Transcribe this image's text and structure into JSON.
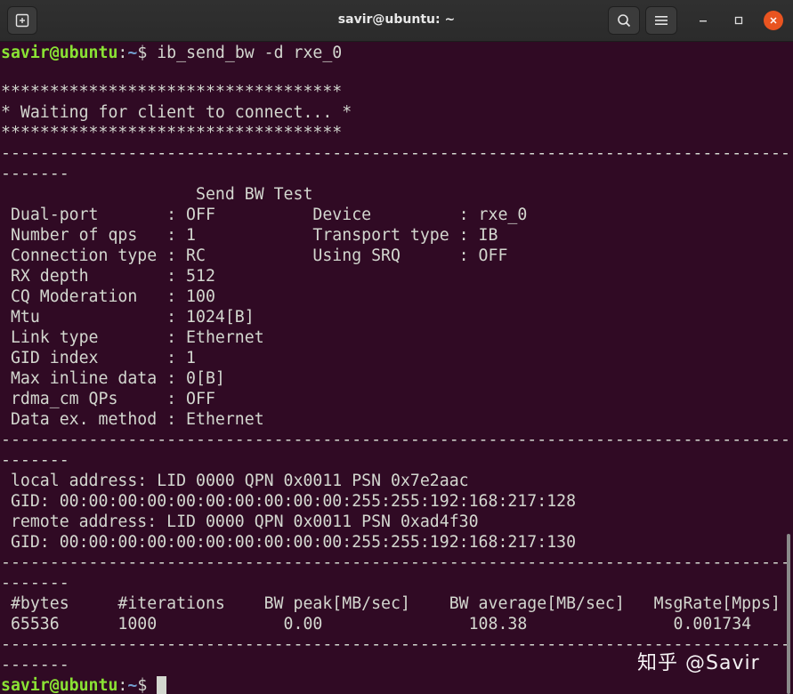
{
  "window": {
    "title": "savir@ubuntu: ~"
  },
  "icons": {
    "new_tab": "new-tab-icon",
    "search": "search-icon",
    "menu": "hamburger-menu-icon",
    "minimize": "minimize-icon",
    "maximize": "maximize-icon",
    "close": "close-icon"
  },
  "colors": {
    "prompt_user": "#8ae234",
    "prompt_path": "#729fcf",
    "background": "#300a24",
    "close_button": "#e95420"
  },
  "prompt": {
    "user": "savir@ubuntu",
    "sep": ":",
    "path": "~",
    "symbol": "$"
  },
  "command": " ib_send_bw -d rxe_0",
  "output": [
    "***********************************",
    "* Waiting for client to connect... *",
    "***********************************",
    "---------------------------------------------------------------------------------",
    "-------",
    "                    Send BW Test",
    " Dual-port       : OFF          Device         : rxe_0",
    " Number of qps   : 1            Transport type : IB",
    " Connection type : RC           Using SRQ      : OFF",
    " RX depth        : 512",
    " CQ Moderation   : 100",
    " Mtu             : 1024[B]",
    " Link type       : Ethernet",
    " GID index       : 1",
    " Max inline data : 0[B]",
    " rdma_cm QPs     : OFF",
    " Data ex. method : Ethernet",
    "---------------------------------------------------------------------------------",
    "-------",
    " local address: LID 0000 QPN 0x0011 PSN 0x7e2aac",
    " GID: 00:00:00:00:00:00:00:00:00:00:255:255:192:168:217:128",
    " remote address: LID 0000 QPN 0x0011 PSN 0xad4f30",
    " GID: 00:00:00:00:00:00:00:00:00:00:255:255:192:168:217:130",
    "---------------------------------------------------------------------------------",
    "-------",
    " #bytes     #iterations    BW peak[MB/sec]    BW average[MB/sec]   MsgRate[Mpps]",
    " 65536      1000             0.00               108.38               0.001734",
    "---------------------------------------------------------------------------------",
    "-------"
  ],
  "watermark": "知乎 @Savir"
}
